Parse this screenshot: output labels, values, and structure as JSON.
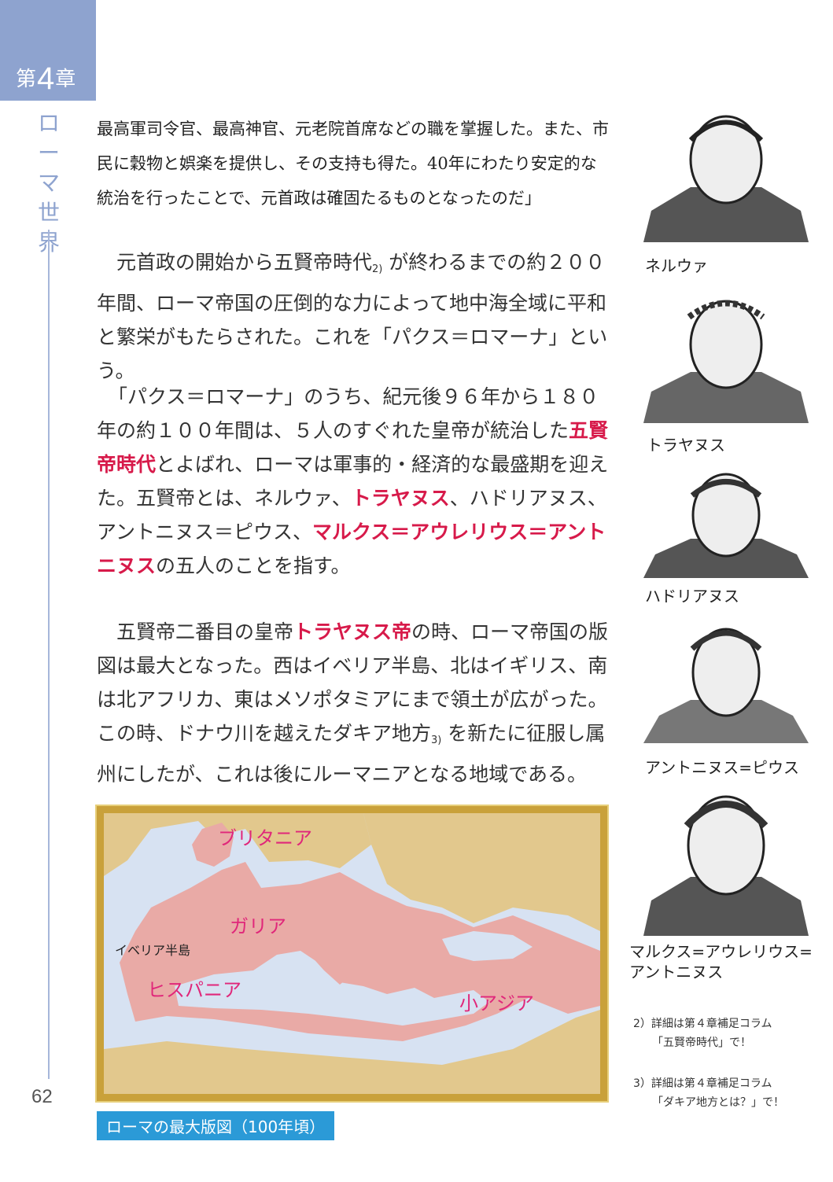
{
  "chapter": {
    "prefix": "第",
    "number": "4",
    "suffix": "章",
    "title": "ローマ世界"
  },
  "page_number": "62",
  "quote": "最高軍司令官、最高神官、元老院首席などの職を掌握した。また、市民に穀物と娯楽を提供し、その支持も得た。40年にわたり安定的な統治を行ったことで、元首政は確固たるものとなったのだ」",
  "para1": {
    "a": "元首政の開始から五賢帝時代",
    "fn": "2)",
    "b": " が終わるまでの約２００年間、ローマ帝国の圧倒的な力によって地中海全域に平和と繁栄がもたらされた。これを「パクス＝ロマーナ」という。"
  },
  "para2": {
    "a": "「パクス＝ロマーナ」のうち、紀元後９６年から１８０年の約１００年間は、５人のすぐれた皇帝が統治した",
    "h1": "五賢帝時代",
    "b": "とよばれ、ローマは軍事的・経済的な最盛期を迎えた。五賢帝とは、ネルウァ、",
    "h2": "トラヤヌス",
    "c": "、ハドリアヌス、アントニヌス＝ピウス、",
    "h3": "マルクス＝アウレリウス＝アントニヌス",
    "d": "の五人のことを指す。"
  },
  "para3": {
    "a": "五賢帝二番目の皇帝",
    "h1": "トラヤヌス帝",
    "b": "の時、ローマ帝国の版図は最大となった。西はイベリア半島、北はイギリス、南は北アフリカ、東はメソポタミアにまで領土が広がった。この時、ドナウ川を越えたダキア地方",
    "fn": "3)",
    "c": " を新たに征服し属州にしたが、これは後にルーマニアとなる地域である。"
  },
  "map": {
    "caption": "ローマの最大版図（100年頃）",
    "labels": {
      "britannia": "ブリタニア",
      "gallia": "ガリア",
      "iberia": "イベリア半島",
      "hispania": "ヒスパニア",
      "asia_minor": "小アジア"
    },
    "colors": {
      "sea": "#d7e2f2",
      "land": "#e2c88d",
      "empire": "#e9aaa6",
      "label": "#e0277a"
    }
  },
  "portraits": [
    {
      "name": "ネルウァ"
    },
    {
      "name": "トラヤヌス"
    },
    {
      "name": "ハドリアヌス"
    },
    {
      "name": "アントニヌス=ピウス"
    },
    {
      "name_line1": "マルクス=アウレリウス=",
      "name_line2": "アントニヌス"
    }
  ],
  "footnotes": [
    {
      "line1": "2）詳細は第４章補足コラム",
      "line2": "「五賢帝時代」で！"
    },
    {
      "line1": "3）詳細は第４章補足コラム",
      "line2": "「ダキア地方とは？」で！"
    }
  ]
}
